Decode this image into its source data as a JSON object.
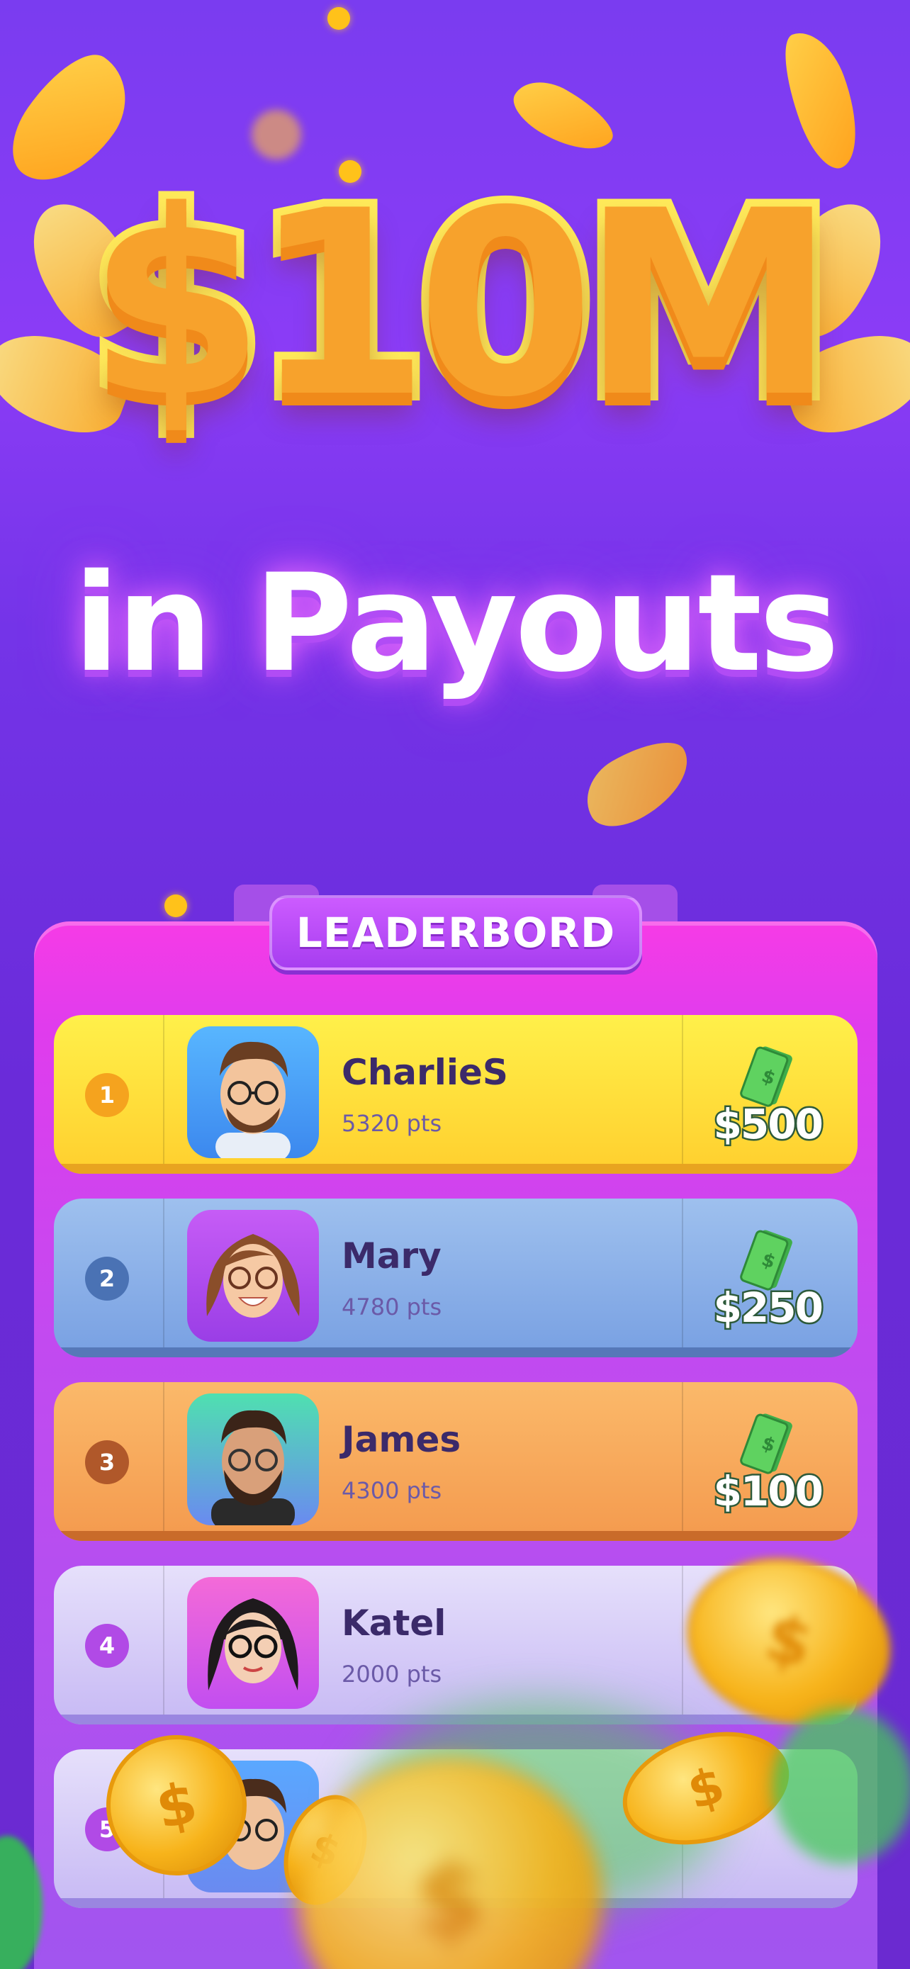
{
  "headline": {
    "amount": "$10M",
    "subtitle": "in Payouts"
  },
  "leaderboard": {
    "title": "LEADERBORD",
    "rows": [
      {
        "rank": "1",
        "name": "CharlieS",
        "points": "5320 pts",
        "prize": "$500",
        "theme": "gold",
        "avatar": "man-glasses-icon"
      },
      {
        "rank": "2",
        "name": "Mary",
        "points": "4780 pts",
        "prize": "$250",
        "theme": "blue",
        "avatar": "woman-glasses-icon"
      },
      {
        "rank": "3",
        "name": "James",
        "points": "4300 pts",
        "prize": "$100",
        "theme": "orange",
        "avatar": "bearded-man-icon"
      },
      {
        "rank": "4",
        "name": "Katel",
        "points": "2000 pts",
        "prize": "",
        "theme": "lavender",
        "avatar": "woman-dark-hair-icon"
      },
      {
        "rank": "5",
        "name": "",
        "points": "",
        "prize": "",
        "theme": "lavender",
        "avatar": "man-glasses-icon"
      }
    ]
  },
  "colors": {
    "background": "#7a3cf0",
    "board": "#e03ced",
    "gold_row": "#ffd83a",
    "blue_row": "#7fa6e6",
    "orange_row": "#f6a356",
    "lavender_row": "#d7cbf7",
    "headline_fill": "#f7a22c",
    "headline_outline": "#ffea5a"
  }
}
